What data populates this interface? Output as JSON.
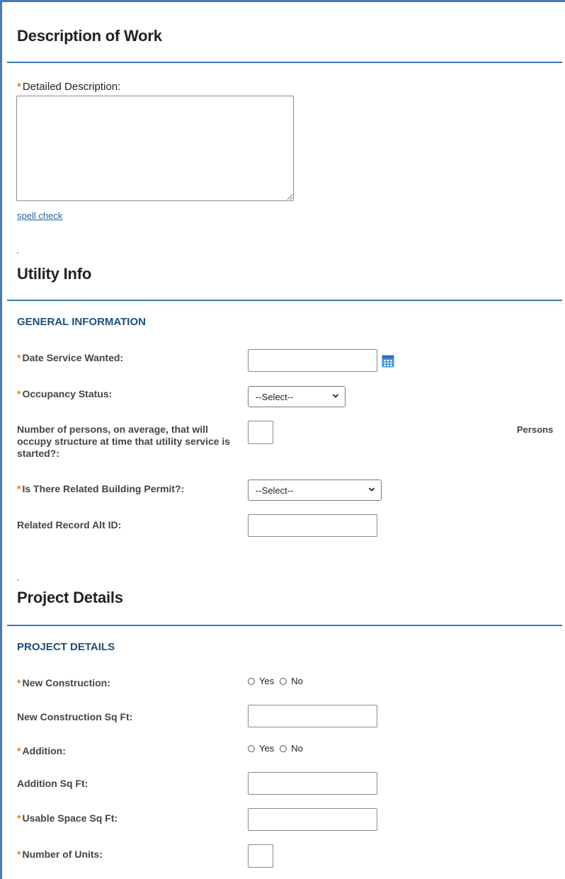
{
  "description_section": {
    "title": "Description of Work",
    "detailed_label": "Detailed Description:",
    "detailed_value": "",
    "spell_check": "spell check"
  },
  "utility_section": {
    "title": "Utility Info",
    "subheading": "GENERAL INFORMATION",
    "date_service_label": "Date Service Wanted:",
    "date_service_value": "",
    "occupancy_label": "Occupancy Status:",
    "occupancy_selected": "--Select--",
    "persons_label": "Number of persons, on average, that will occupy structure at time that utility service is started?:",
    "persons_value": "",
    "persons_suffix": "Persons",
    "related_permit_label": "Is There Related Building Permit?:",
    "related_permit_selected": "--Select--",
    "alt_id_label": "Related Record Alt ID:",
    "alt_id_value": ""
  },
  "project_section": {
    "title": "Project Details",
    "subheading": "PROJECT DETAILS",
    "new_construction_label": "New Construction:",
    "new_construction_sqft_label": "New Construction Sq Ft:",
    "addition_label": "Addition:",
    "addition_sqft_label": "Addition Sq Ft:",
    "usable_space_label": "Usable Space Sq Ft:",
    "units_label": "Number of Units:",
    "yes_label": "Yes",
    "no_label": "No"
  },
  "required_marker": "*",
  "colors": {
    "accent_rule": "#3a78b4",
    "subheading": "#1c4f7c",
    "required": "#d9822b",
    "link": "#2264a8",
    "calendar_icon": "#3b8fd9"
  }
}
